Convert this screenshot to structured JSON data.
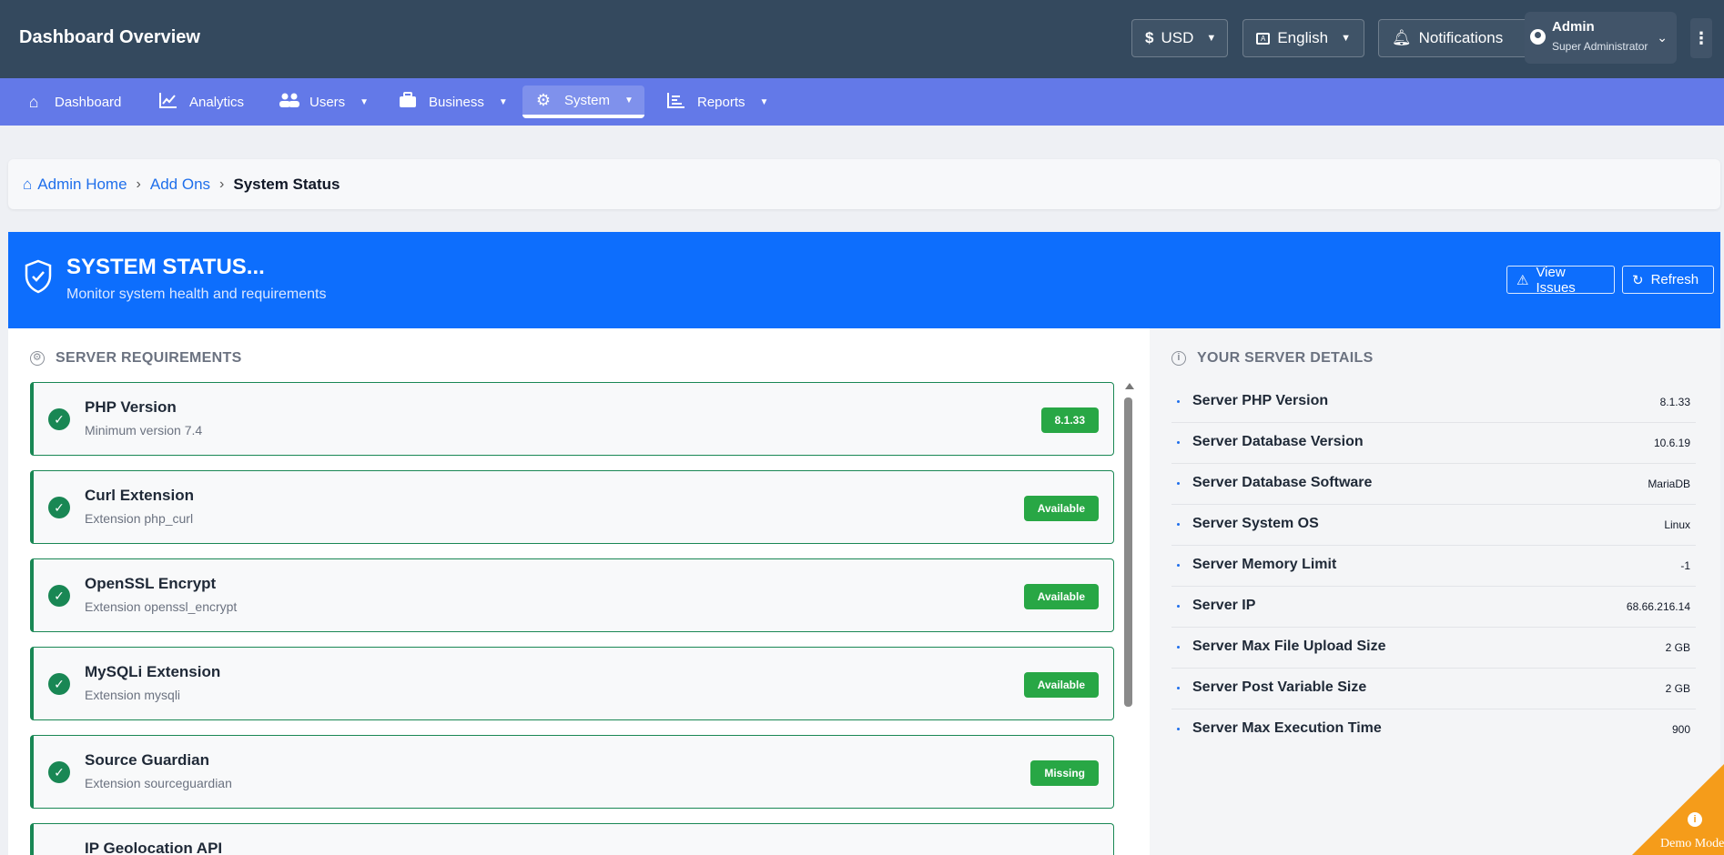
{
  "header": {
    "title": "Dashboard Overview",
    "currency": "USD",
    "language": "English",
    "notifications_label": "Notifications",
    "user_name": "Admin",
    "user_role": "Super Administrator"
  },
  "nav": {
    "items": [
      {
        "label": "Dashboard",
        "icon": "home-icon"
      },
      {
        "label": "Analytics",
        "icon": "chart-line-icon"
      },
      {
        "label": "Users",
        "icon": "users-icon"
      },
      {
        "label": "Business",
        "icon": "briefcase-icon"
      },
      {
        "label": "System",
        "icon": "gears-icon"
      },
      {
        "label": "Reports",
        "icon": "bar-chart-icon"
      }
    ],
    "active": "System"
  },
  "breadcrumb": {
    "home": "Admin Home",
    "parent": "Add Ons",
    "current": "System Status"
  },
  "hero": {
    "title": "SYSTEM STATUS...",
    "subtitle": "Monitor system health and requirements",
    "view_issues_label": "View Issues",
    "refresh_label": "Refresh"
  },
  "requirements": {
    "heading": "SERVER REQUIREMENTS",
    "items": [
      {
        "name": "PHP Version",
        "desc": "Minimum version 7.4",
        "status": "8.1.33"
      },
      {
        "name": "Curl Extension",
        "desc": "Extension php_curl",
        "status": "Available"
      },
      {
        "name": "OpenSSL Encrypt",
        "desc": "Extension openssl_encrypt",
        "status": "Available"
      },
      {
        "name": "MySQLi Extension",
        "desc": "Extension mysqli",
        "status": "Available"
      },
      {
        "name": "Source Guardian",
        "desc": "Extension sourceguardian",
        "status": "Missing"
      },
      {
        "name": "IP Geolocation API",
        "desc": "",
        "status": ""
      }
    ]
  },
  "server_details": {
    "heading": "YOUR SERVER DETAILS",
    "rows": [
      {
        "label": "Server PHP Version",
        "value": "8.1.33"
      },
      {
        "label": "Server Database Version",
        "value": "10.6.19"
      },
      {
        "label": "Server Database Software",
        "value": "MariaDB"
      },
      {
        "label": "Server System OS",
        "value": "Linux"
      },
      {
        "label": "Server Memory Limit",
        "value": "-1"
      },
      {
        "label": "Server IP",
        "value": "68.66.216.14"
      },
      {
        "label": "Server Max File Upload Size",
        "value": "2 GB"
      },
      {
        "label": "Server Post Variable Size",
        "value": "2 GB"
      },
      {
        "label": "Server Max Execution Time",
        "value": "900"
      }
    ]
  },
  "demo_mode_label": "Demo Mode",
  "colors": {
    "header_bg": "#34495e",
    "nav_bg": "#6379e8",
    "hero_bg": "#0d6efd",
    "success": "#198754",
    "badge": "#28a745",
    "demo_corner": "#f59c1a"
  }
}
